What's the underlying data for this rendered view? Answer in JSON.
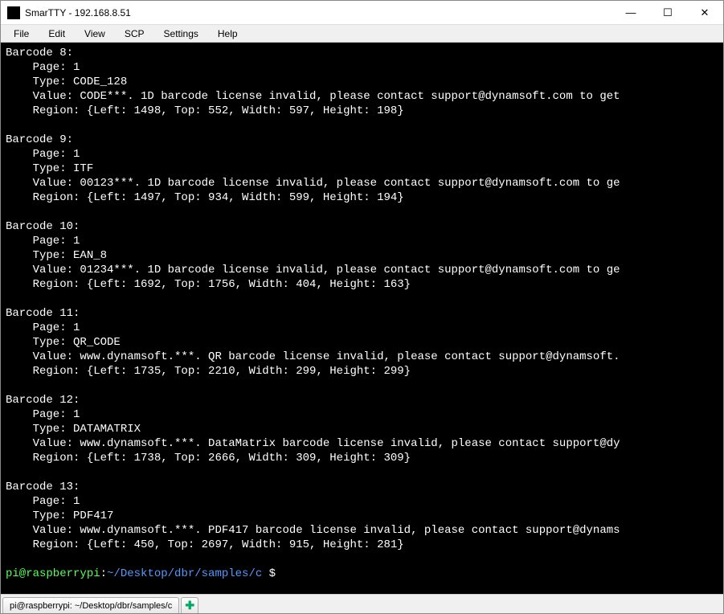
{
  "window": {
    "title": "SmarTTY - 192.168.8.51",
    "min": "—",
    "max": "☐",
    "close": "✕"
  },
  "menu": {
    "file": "File",
    "edit": "Edit",
    "view": "View",
    "scp": "SCP",
    "settings": "Settings",
    "help": "Help"
  },
  "barcodes": [
    {
      "header": "Barcode 8:",
      "page": "    Page: 1",
      "type": "    Type: CODE_128",
      "value": "    Value: CODE***. 1D barcode license invalid, please contact support@dynamsoft.com to get",
      "region": "    Region: {Left: 1498, Top: 552, Width: 597, Height: 198}"
    },
    {
      "header": "Barcode 9:",
      "page": "    Page: 1",
      "type": "    Type: ITF",
      "value": "    Value: 00123***. 1D barcode license invalid, please contact support@dynamsoft.com to ge",
      "region": "    Region: {Left: 1497, Top: 934, Width: 599, Height: 194}"
    },
    {
      "header": "Barcode 10:",
      "page": "    Page: 1",
      "type": "    Type: EAN_8",
      "value": "    Value: 01234***. 1D barcode license invalid, please contact support@dynamsoft.com to ge",
      "region": "    Region: {Left: 1692, Top: 1756, Width: 404, Height: 163}"
    },
    {
      "header": "Barcode 11:",
      "page": "    Page: 1",
      "type": "    Type: QR_CODE",
      "value": "    Value: www.dynamsoft.***. QR barcode license invalid, please contact support@dynamsoft.",
      "region": "    Region: {Left: 1735, Top: 2210, Width: 299, Height: 299}"
    },
    {
      "header": "Barcode 12:",
      "page": "    Page: 1",
      "type": "    Type: DATAMATRIX",
      "value": "    Value: www.dynamsoft.***. DataMatrix barcode license invalid, please contact support@dy",
      "region": "    Region: {Left: 1738, Top: 2666, Width: 309, Height: 309}"
    },
    {
      "header": "Barcode 13:",
      "page": "    Page: 1",
      "type": "    Type: PDF417",
      "value": "    Value: www.dynamsoft.***. PDF417 barcode license invalid, please contact support@dynams",
      "region": "    Region: {Left: 450, Top: 2697, Width: 915, Height: 281}"
    }
  ],
  "prompt": {
    "user": "pi@raspberrypi",
    "colon": ":",
    "path": "~/Desktop/dbr/samples/c ",
    "dollar": "$"
  },
  "tabs": {
    "tab1": "pi@raspberrypi: ~/Desktop/dbr/samples/c",
    "add": "✚"
  }
}
